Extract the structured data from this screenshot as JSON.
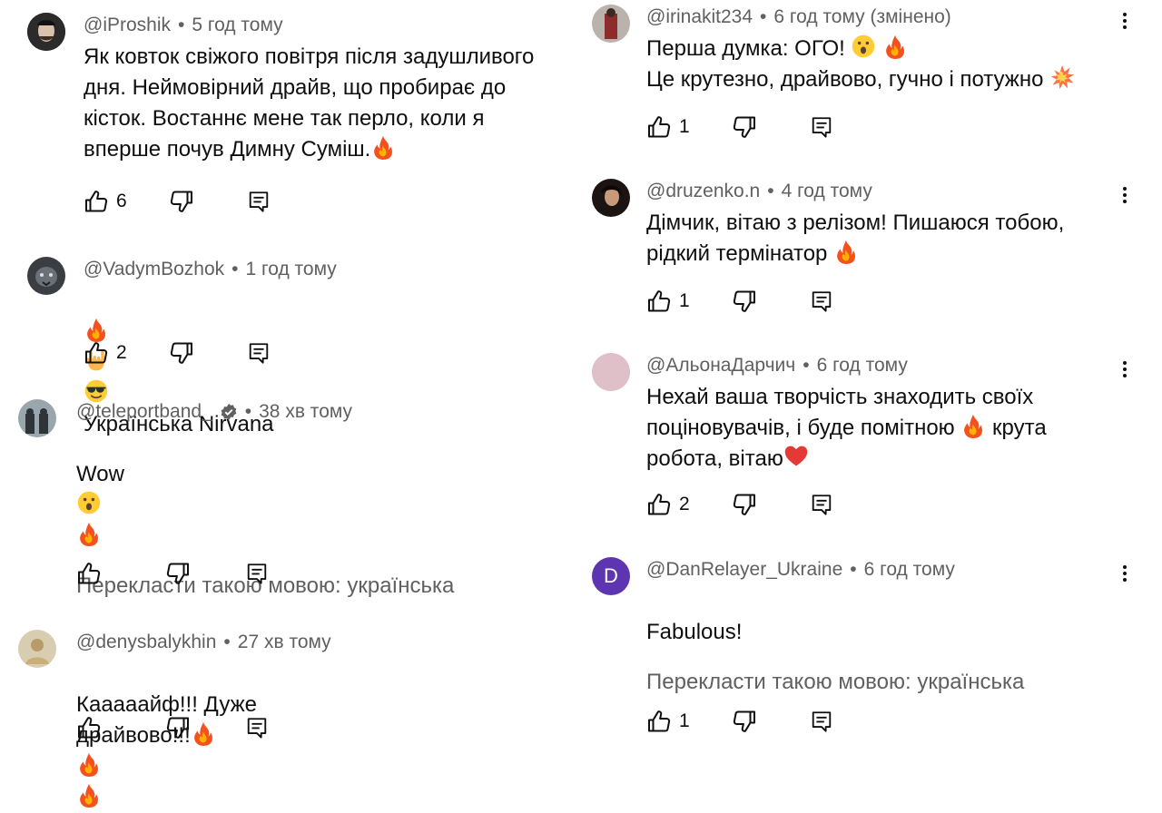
{
  "comments": [
    {
      "author": "@iProshik",
      "time": "5 год тому",
      "text": "Як ковток свіжого повітря після задушливого\nдня. Неймовірний драйв, що пробирає до\nкісток. Востаннє мене так перло, коли я\nвперше почув Димну Суміш.",
      "text_emoji": [
        "fire"
      ],
      "likes": "6"
    },
    {
      "author": "@VadymBozhok",
      "time": "1 год тому",
      "text": "Українська Nirvana",
      "text_emoji_prefix": [
        "fire",
        "rock-hand",
        "sunglasses-face"
      ],
      "likes": "2"
    },
    {
      "author": "@teleportband_",
      "verified": true,
      "time": "38 хв тому",
      "text": "Wow",
      "text_emoji": [
        "surprised-face",
        "fire"
      ],
      "translate": "Перекласти такою мовою: українська",
      "likes": ""
    },
    {
      "author": "@denysbalykhin",
      "time": "27 хв тому",
      "text": "Кааааайф!!! Дуже драйвово!!!",
      "text_emoji": [
        "fire",
        "fire",
        "fire"
      ],
      "likes": ""
    },
    {
      "author": "@irinakit234",
      "time": "6 год тому (змінено)",
      "line1": "Перша думка: ОГО!",
      "line1_emoji": [
        "surprised-face",
        "fire"
      ],
      "line2": "Це крутезно, драйвово, гучно і потужно",
      "line2_emoji": [
        "collision"
      ],
      "likes": "1"
    },
    {
      "author": "@druzenko.n",
      "time": "4 год тому",
      "line1": "Дімчик, вітаю з релізом! Пишаюся тобою,",
      "line2": "рідкий термінатор",
      "line2_emoji": [
        "fire"
      ],
      "likes": "1"
    },
    {
      "author": "@АльонаДарчич",
      "time": "6 год тому",
      "line1": "Нехай ваша творчість знаходить своїх",
      "line2a": "поціновувачів, і буде помітною",
      "line2b": "крута",
      "line3": "робота, вітаю",
      "emoji_mid": [
        "fire"
      ],
      "emoji_end": [
        "red-heart"
      ],
      "likes": "2"
    },
    {
      "author": "@DanRelayer_Ukraine",
      "avatar_letter": "D",
      "time": "6 год тому",
      "text": "Fabulous!",
      "translate": "Перекласти такою мовою: українська",
      "likes": "1"
    }
  ],
  "separator": "•",
  "colors": {
    "text": "#0f0f0f",
    "meta": "#606060",
    "avatar_d": "#5e35b1"
  },
  "icons": [
    "thumbs-up-icon",
    "thumbs-down-icon",
    "reply-icon",
    "more-vert-icon",
    "verified-icon"
  ]
}
